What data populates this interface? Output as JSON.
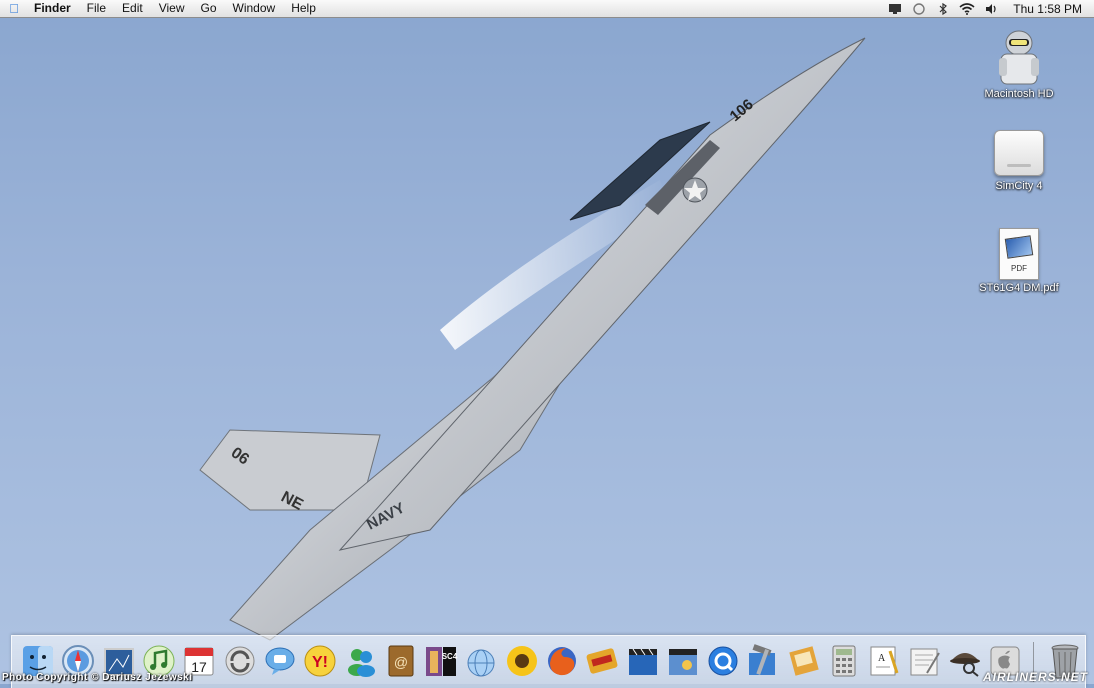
{
  "menubar": {
    "apple_icon": "apple-icon",
    "app_name": "Finder",
    "menus": [
      "File",
      "Edit",
      "View",
      "Go",
      "Window",
      "Help"
    ],
    "status_icons": [
      "display-icon",
      "sync-icon",
      "bluetooth-icon",
      "wifi-icon",
      "volume-icon"
    ],
    "clock": "Thu 1:58 PM"
  },
  "wallpaper": {
    "tail_number": "06",
    "nose_number": "106",
    "tail_code": "NE",
    "fuselage_text": "NAVY"
  },
  "desktop_icons": [
    {
      "label": "Macintosh HD",
      "icon": "hard-drive-icon"
    },
    {
      "label": "SimCity 4",
      "icon": "disk-image-icon"
    },
    {
      "label": "ST61G4 DM.pdf",
      "icon": "pdf-document-icon",
      "tag": "PDF"
    }
  ],
  "dock": {
    "items": [
      {
        "name": "finder",
        "icon": "finder-icon"
      },
      {
        "name": "safari",
        "icon": "safari-icon"
      },
      {
        "name": "preview",
        "icon": "preview-icon"
      },
      {
        "name": "itunes",
        "icon": "itunes-icon"
      },
      {
        "name": "ical",
        "icon": "calendar-icon",
        "text": "17"
      },
      {
        "name": "isync",
        "icon": "sync-icon"
      },
      {
        "name": "ichat",
        "icon": "ichat-icon"
      },
      {
        "name": "yahoo-messenger",
        "icon": "yahoo-messenger-icon"
      },
      {
        "name": "msn-messenger",
        "icon": "msn-messenger-icon"
      },
      {
        "name": "address-book",
        "icon": "address-book-icon"
      },
      {
        "name": "simcity-4",
        "icon": "simcity-icon",
        "text": "SC4"
      },
      {
        "name": "network-utility",
        "icon": "globe-icon"
      },
      {
        "name": "sunflower",
        "icon": "sunflower-icon"
      },
      {
        "name": "firefox",
        "icon": "firefox-icon"
      },
      {
        "name": "quicken",
        "icon": "quicken-icon"
      },
      {
        "name": "imovie",
        "icon": "clapper-icon"
      },
      {
        "name": "iphoto-slideshow",
        "icon": "clapper-photo-icon"
      },
      {
        "name": "quicktime",
        "icon": "quicktime-icon"
      },
      {
        "name": "xcode",
        "icon": "xcode-hammer-icon"
      },
      {
        "name": "scrapbook",
        "icon": "scrapbook-icon"
      },
      {
        "name": "calculator",
        "icon": "calculator-icon"
      },
      {
        "name": "textedit",
        "icon": "textedit-icon"
      },
      {
        "name": "pages",
        "icon": "pages-icon"
      },
      {
        "name": "sherlock",
        "icon": "sherlock-icon"
      },
      {
        "name": "system-preferences",
        "icon": "apple-prefs-icon"
      }
    ],
    "trash_icon": "trash-icon"
  },
  "credit": "Photo Copyright © Dariusz Jezewski",
  "watermark": "AIRLINERS.NET"
}
